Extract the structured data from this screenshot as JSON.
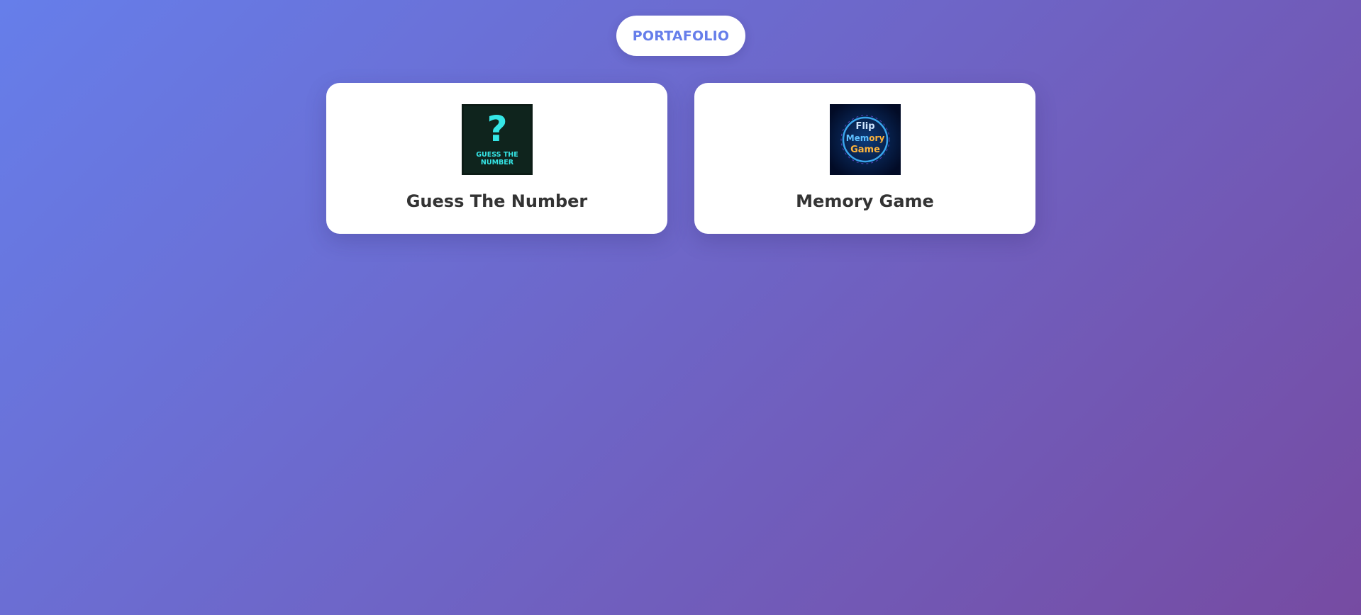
{
  "header": {
    "portfolio_label": "PORTAFOLIO"
  },
  "cards": [
    {
      "title": "Guess The Number",
      "icon": "guess-the-number-thumbnail",
      "thumb_line1": "GUESS THE",
      "thumb_line2": "NUMBER",
      "thumb_glyph": "?"
    },
    {
      "title": "Memory Game",
      "icon": "flip-memory-game-thumbnail",
      "thumb_line1": "Flip",
      "thumb_word_a": "Mem",
      "thumb_word_b": "ory",
      "thumb_line3": "Game"
    }
  ],
  "colors": {
    "gradient_start": "#667eea",
    "gradient_end": "#764ba2",
    "accent": "#667eea",
    "card_text": "#333333"
  }
}
